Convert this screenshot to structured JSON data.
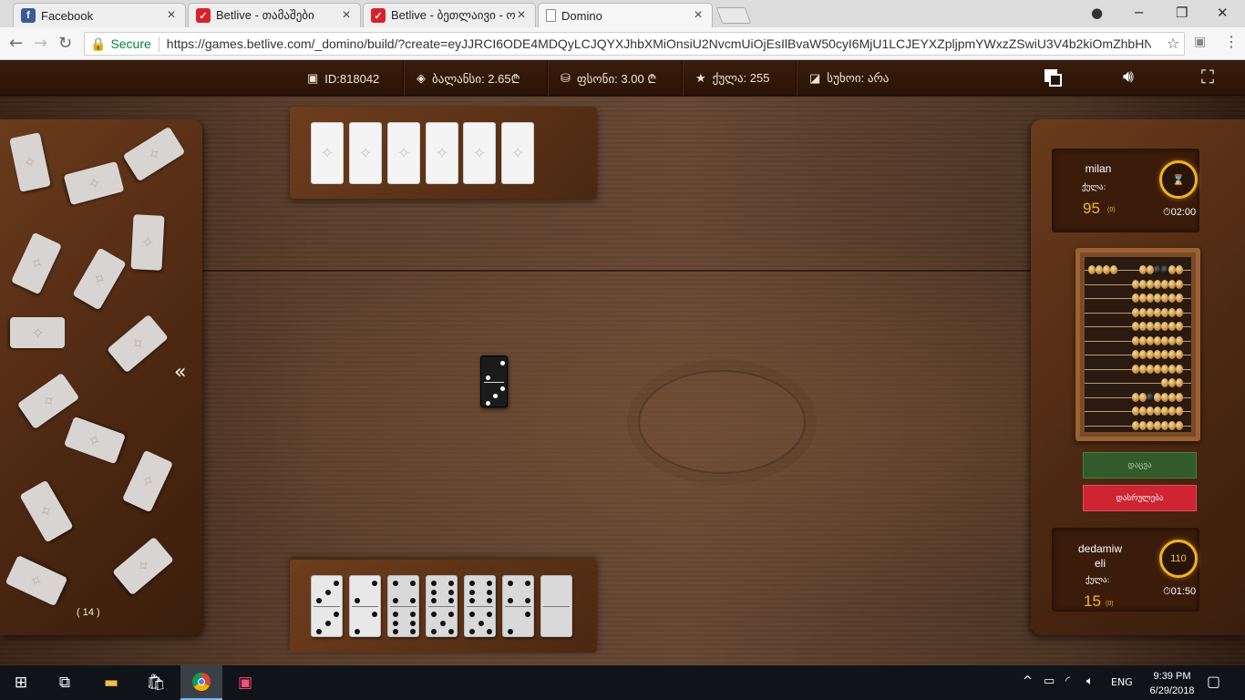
{
  "browser": {
    "tabs": [
      {
        "title": "Facebook",
        "icon": "facebook-icon",
        "color": "#3b5998"
      },
      {
        "title": "Betlive - თამაშები",
        "icon": "betlive-icon",
        "color": "#d8232a"
      },
      {
        "title": "Betlive - ბეთლაივი - ო",
        "icon": "betlive-icon",
        "color": "#d8232a"
      },
      {
        "title": "Domino",
        "icon": "page-icon",
        "color": "#ffffff"
      }
    ],
    "secure_label": "Secure",
    "url": "https://games.betlive.com/_domino/build/?create=eyJJRCI6ODE4MDQyLCJQYXJhbXMiOnsiU2NvcmUiOjEsIlBvaW50cyI6MjU1LCJEYXZpljpmYWxzZSwiU3V4b2kiOmZhbHNILCJN..."
  },
  "header": {
    "id": "ID:818042",
    "balance": "ბალანსი: 2.65₾",
    "bet": "ფსონი: 3.00 ₾",
    "points": "ქულა: 255",
    "double": "სუხოი: არა"
  },
  "boneyard": {
    "count": "( 14 )"
  },
  "board": {
    "tile": [
      2,
      3
    ]
  },
  "player_hand": [
    [
      3,
      3
    ],
    [
      2,
      2
    ],
    [
      4,
      6
    ],
    [
      6,
      5
    ],
    [
      6,
      5
    ],
    [
      4,
      2
    ],
    [
      0,
      0
    ]
  ],
  "opponent": {
    "name": "milan",
    "score_label": "ქულა:",
    "score": "95",
    "score_sub": "(0)",
    "timer": "02:00",
    "ring_icon": "hourglass-icon"
  },
  "player": {
    "name": "dedamiw eli",
    "score_label": "ქულა:",
    "score": "15",
    "score_sub": "(0)",
    "timer": "01:50",
    "ring_value": "110"
  },
  "buttons": {
    "draw": "დაცვა",
    "finish": "დასრულება"
  },
  "taskbar": {
    "lang": "ENG",
    "time": "9:39 PM",
    "date": "6/29/2018"
  },
  "colors": {
    "accent_gold": "#f0b72a",
    "finish_red": "#cf2432",
    "draw_green": "#325a2a"
  }
}
